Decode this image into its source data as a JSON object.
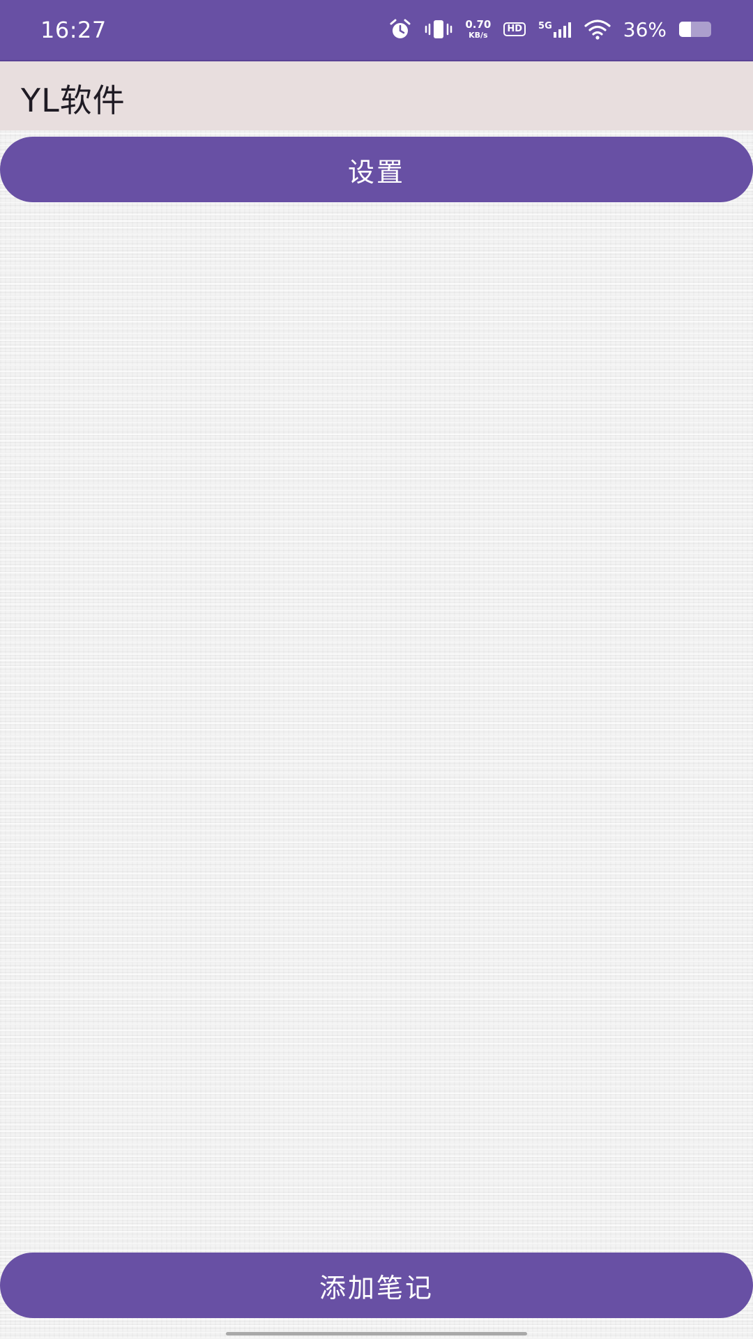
{
  "status_bar": {
    "time": "16:27",
    "net_speed_value": "0.70",
    "net_speed_unit": "KB/s",
    "hd_label": "HD",
    "network_label": "5G",
    "battery_percent_label": "36%",
    "battery_level": 0.36,
    "icons": [
      "alarm-icon",
      "vibrate-icon",
      "signal-icon",
      "wifi-icon",
      "battery-icon"
    ]
  },
  "app_bar": {
    "title": "YL软件"
  },
  "actions": {
    "settings_label": "设置",
    "add_note_label": "添加笔记"
  },
  "theme": {
    "primary": "#6850a4",
    "app_bar_bg": "#e8dede",
    "text_dark": "#1f1b24"
  }
}
